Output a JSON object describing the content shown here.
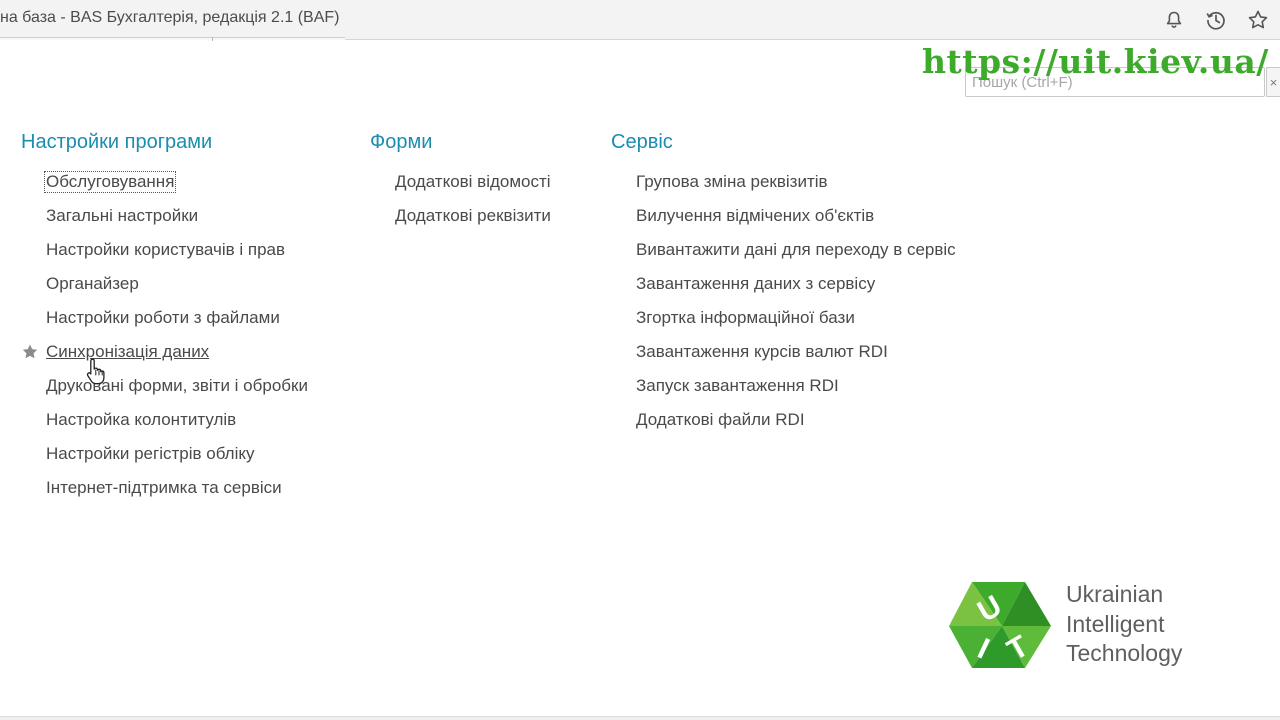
{
  "window": {
    "title": "на база - BAS Бухгалтерія, редакція 2.1  (BAF)"
  },
  "toolbar_icons": [
    "bell-icon",
    "history-icon",
    "star-icon"
  ],
  "watermark": "https://uit.kiev.ua/",
  "search": {
    "placeholder": "Пошук (Ctrl+F)",
    "value": "",
    "clear_label": "×"
  },
  "sections": {
    "settings": {
      "title": "Настройки програми",
      "items": [
        "Обслуговування",
        "Загальні настройки",
        "Настройки користувачів і прав",
        "Органайзер",
        "Настройки роботи з файлами",
        "Синхронізація даних",
        "Друковані форми, звіти і обробки",
        "Настройка колонтитулів",
        "Настройки регістрів обліку",
        "Інтернет-підтримка та сервіси"
      ]
    },
    "forms": {
      "title": "Форми",
      "items": [
        "Додаткові відомості",
        "Додаткові реквізити"
      ]
    },
    "service": {
      "title": "Сервіс",
      "items": [
        "Групова зміна реквізитів",
        "Вилучення відмічених об'єктів",
        "Вивантажити дані для переходу в сервіс",
        "Завантаження даних з сервісу",
        "Згортка інформаційної бази",
        "Завантаження курсів валют RDI",
        "Запуск завантаження RDI",
        "Додаткові файли RDI"
      ]
    }
  },
  "logo": {
    "lines": [
      "Ukrainian",
      "Intelligent",
      "Technology"
    ],
    "brand_color": "#3daa2b"
  },
  "colors": {
    "heading": "#1a8db0",
    "text": "#4a4a4a",
    "accent_green": "#3daa2b"
  }
}
